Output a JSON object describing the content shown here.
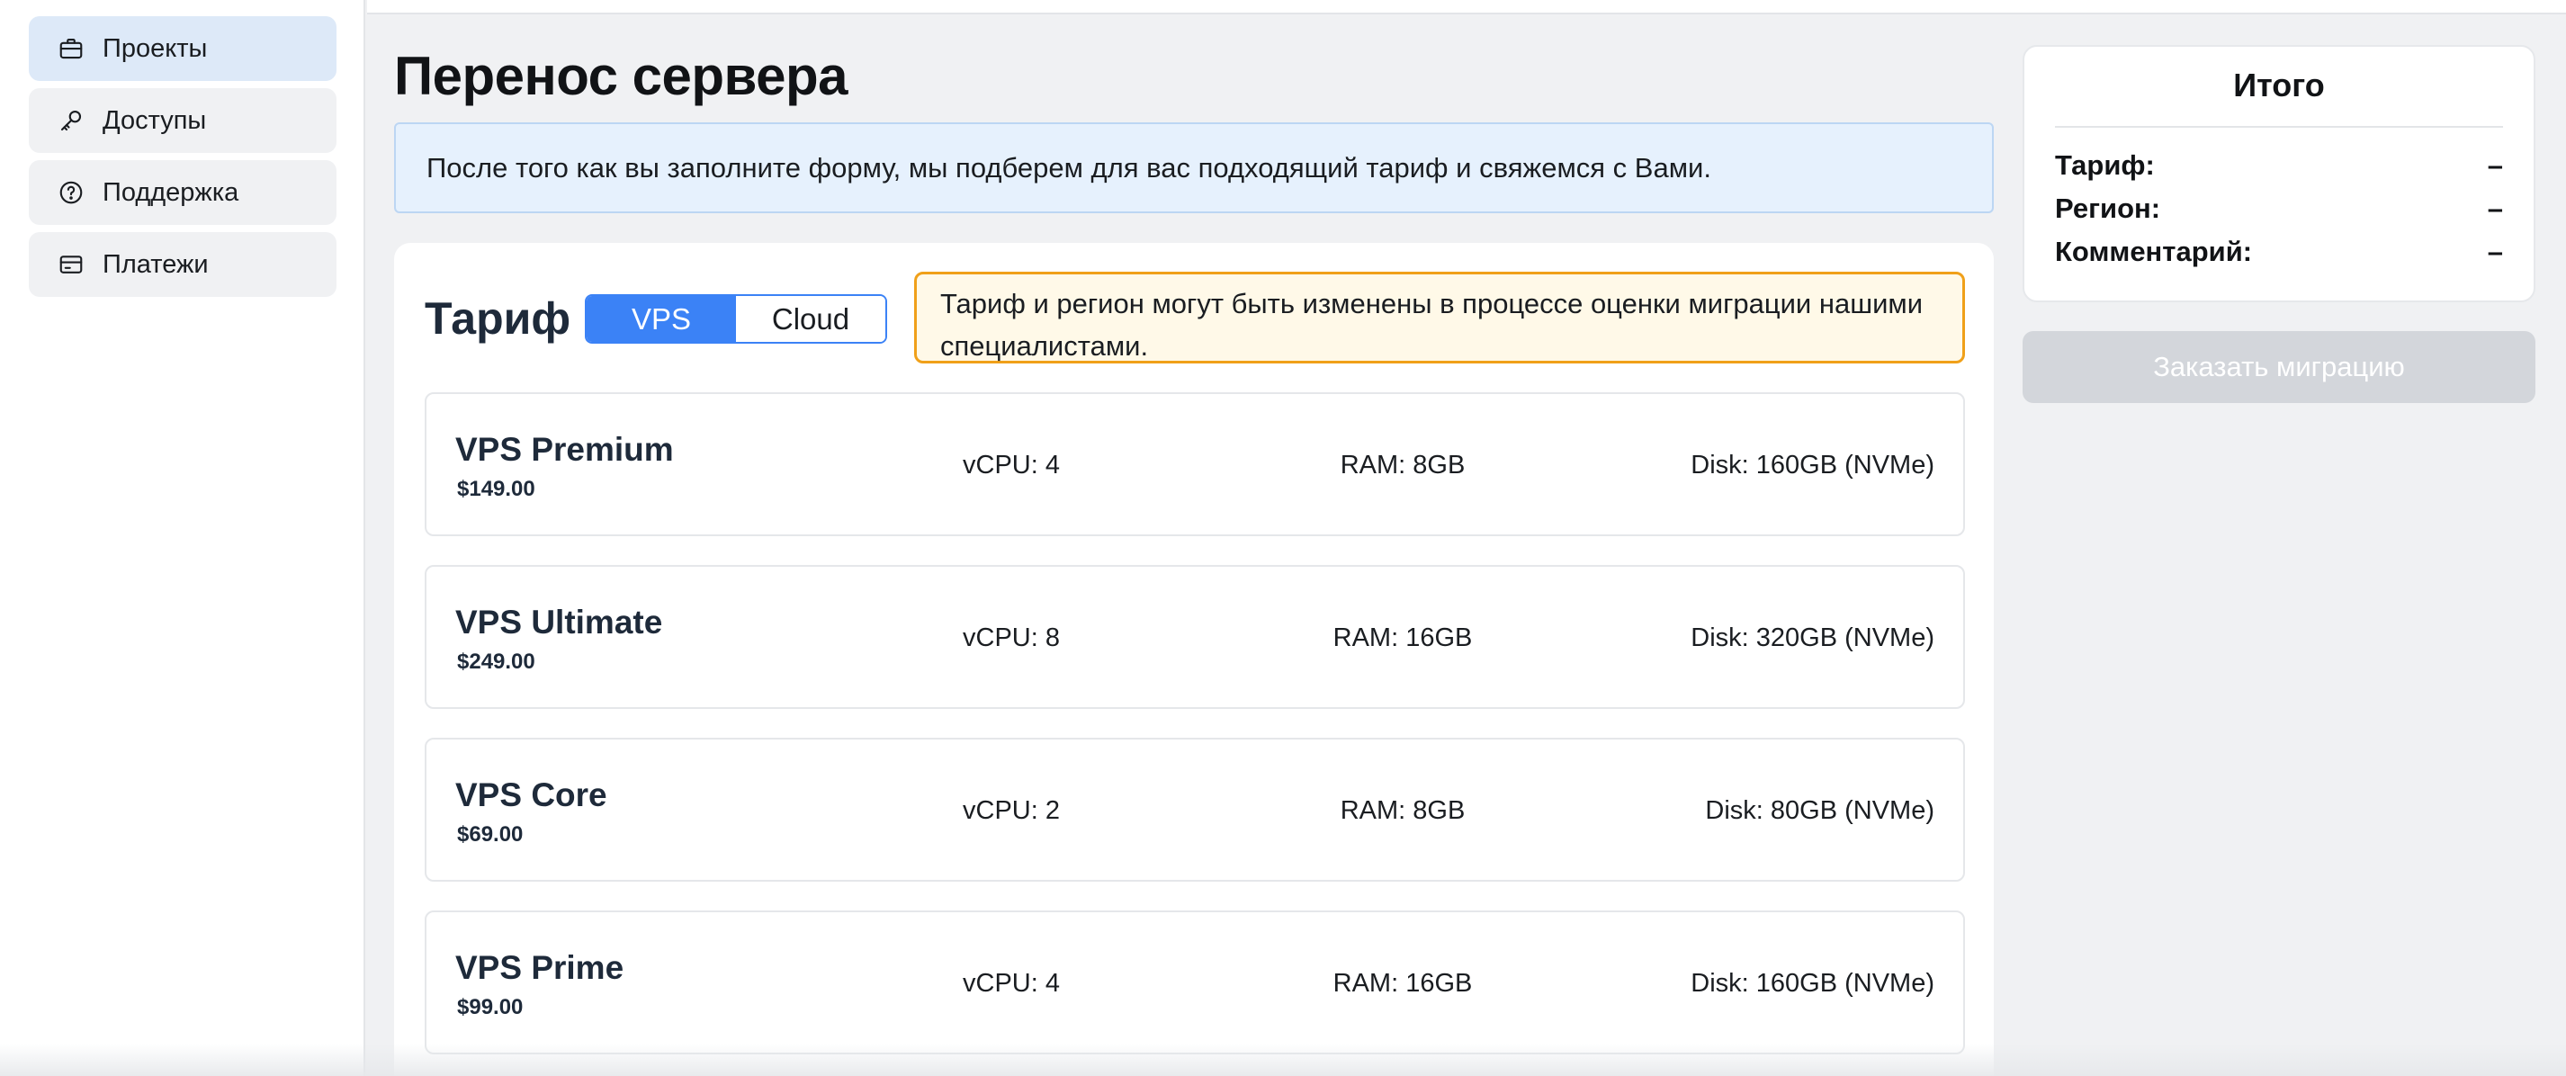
{
  "sidebar": {
    "items": [
      {
        "label": "Проекты",
        "icon": "briefcase-icon",
        "active": true
      },
      {
        "label": "Доступы",
        "icon": "key-icon",
        "active": false
      },
      {
        "label": "Поддержка",
        "icon": "help-circle-icon",
        "active": false
      },
      {
        "label": "Платежи",
        "icon": "credit-card-icon",
        "active": false
      }
    ]
  },
  "page": {
    "title": "Перенос сервера",
    "info_banner": "После того как вы заполните форму, мы подберем для вас подходящий тариф и свяжемся с Вами."
  },
  "tariff": {
    "title": "Тариф",
    "toggle": {
      "options": [
        "VPS",
        "Cloud"
      ],
      "selected": "VPS"
    },
    "warning": "Тариф и регион могут быть изменены в процессе оценки миграции нашими специалистами.",
    "plans": [
      {
        "name": "VPS Premium",
        "price": "$149.00",
        "cpu": "vCPU: 4",
        "ram": "RAM: 8GB",
        "disk": "Disk: 160GB (NVMe)"
      },
      {
        "name": "VPS Ultimate",
        "price": "$249.00",
        "cpu": "vCPU: 8",
        "ram": "RAM: 16GB",
        "disk": "Disk: 320GB (NVMe)"
      },
      {
        "name": "VPS Core",
        "price": "$69.00",
        "cpu": "vCPU: 2",
        "ram": "RAM: 8GB",
        "disk": "Disk: 80GB (NVMe)"
      },
      {
        "name": "VPS Prime",
        "price": "$99.00",
        "cpu": "vCPU: 4",
        "ram": "RAM: 16GB",
        "disk": "Disk: 160GB (NVMe)"
      }
    ]
  },
  "summary": {
    "title": "Итого",
    "rows": [
      {
        "label": "Тариф:",
        "value": "–"
      },
      {
        "label": "Регион:",
        "value": "–"
      },
      {
        "label": "Комментарий:",
        "value": "–"
      }
    ],
    "order_button": "Заказать миграцию",
    "order_button_disabled": true
  },
  "colors": {
    "accent": "#3b82f6",
    "active_nav": "#dde9f8",
    "warning_border": "#f0a019",
    "info_bg": "#e6f1fd"
  }
}
